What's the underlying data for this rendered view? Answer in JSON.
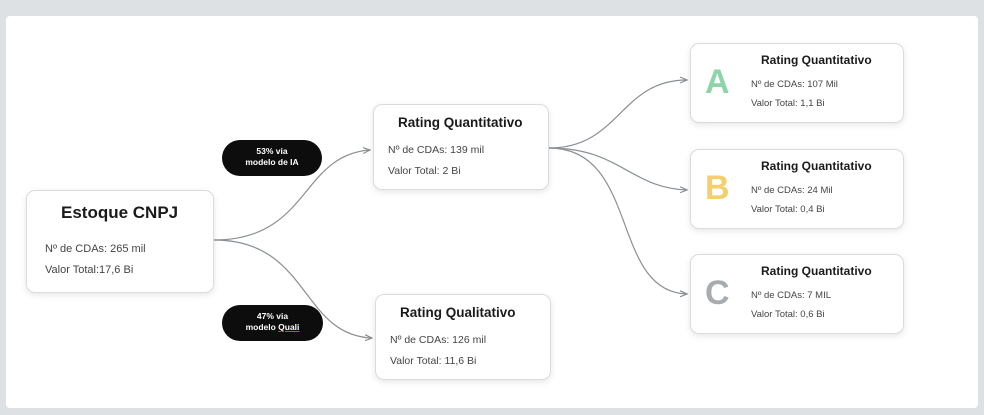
{
  "colors": {
    "rating_a": "#8fd4a8",
    "rating_b": "#f4cf6b",
    "rating_c": "#a9acaf",
    "pill_bg": "#0d0d0d"
  },
  "root": {
    "title": "Estoque CNPJ",
    "cdas": "Nº de CDAs:  265 mil",
    "valor": "Valor Total:17,6 Bi"
  },
  "pill_ia": {
    "line1": "53% via",
    "line2": "modelo de IA"
  },
  "pill_quali": {
    "line1": "47% via",
    "line2_prefix": "modelo ",
    "line2_word": "Quali"
  },
  "quant": {
    "title": "Rating Quantitativo",
    "cdas": "Nº de CDAs: 139 mil",
    "valor": "Valor Total:  2 Bi"
  },
  "quali": {
    "title": "Rating Qualitativo",
    "cdas": "Nº de CDAs: 126 mil",
    "valor": "Valor Total: 11,6 Bi"
  },
  "leaves": [
    {
      "letter": "A",
      "title": "Rating Quantitativo",
      "cdas": "Nº de CDAs: 107 Mil",
      "valor": "Valor Total: 1,1 Bi"
    },
    {
      "letter": "B",
      "title": "Rating Quantitativo",
      "cdas": "Nº de CDAs: 24 Mil",
      "valor": "Valor Total: 0,4 Bi"
    },
    {
      "letter": "C",
      "title": "Rating Quantitativo",
      "cdas": "Nº de CDAs: 7 MIL",
      "valor": "Valor Total: 0,6 Bi"
    }
  ]
}
